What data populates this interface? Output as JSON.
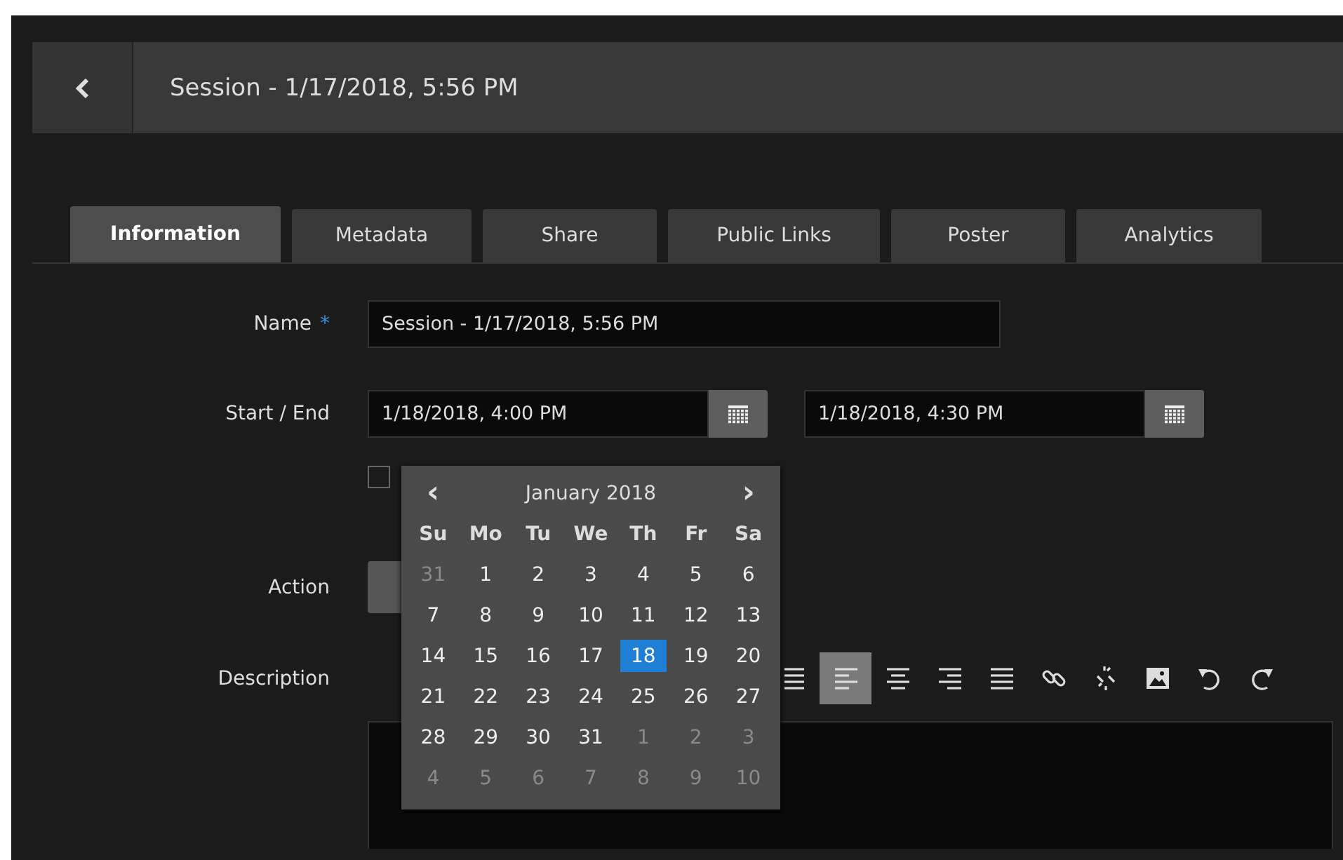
{
  "header": {
    "title": "Session - 1/17/2018, 5:56 PM"
  },
  "tabs": [
    {
      "label": "Information",
      "selected": true
    },
    {
      "label": "Metadata",
      "selected": false
    },
    {
      "label": "Share",
      "selected": false
    },
    {
      "label": "Public Links",
      "selected": false
    },
    {
      "label": "Poster",
      "selected": false
    },
    {
      "label": "Analytics",
      "selected": false
    }
  ],
  "form": {
    "name_label": "Name",
    "required_mark": "*",
    "name_value": "Session - 1/17/2018, 5:56 PM",
    "start_end_label": "Start / End",
    "start_value": "1/18/2018, 4:00 PM",
    "end_value": "1/18/2018, 4:30 PM",
    "all_day_checked": false,
    "action_label": "Action",
    "description_label": "Description"
  },
  "toolbar": [
    {
      "kind": "list",
      "selected": false
    },
    {
      "kind": "align-left",
      "selected": true
    },
    {
      "kind": "align-center",
      "selected": false
    },
    {
      "kind": "align-right",
      "selected": false
    },
    {
      "kind": "justify",
      "selected": false
    },
    {
      "kind": "link",
      "selected": false
    },
    {
      "kind": "unlink",
      "selected": false
    },
    {
      "kind": "image",
      "selected": false
    },
    {
      "kind": "undo",
      "selected": false
    },
    {
      "kind": "redo",
      "selected": false
    }
  ],
  "calendar": {
    "prev": "‹",
    "month": "January 2018",
    "next": "›",
    "weekdays": [
      "Su",
      "Mo",
      "Tu",
      "We",
      "Th",
      "Fr",
      "Sa"
    ],
    "weeks": [
      [
        {
          "label": "31",
          "muted": true,
          "selected": false
        },
        {
          "label": "1",
          "muted": false,
          "selected": false
        },
        {
          "label": "2",
          "muted": false,
          "selected": false
        },
        {
          "label": "3",
          "muted": false,
          "selected": false
        },
        {
          "label": "4",
          "muted": false,
          "selected": false
        },
        {
          "label": "5",
          "muted": false,
          "selected": false
        },
        {
          "label": "6",
          "muted": false,
          "selected": false
        }
      ],
      [
        {
          "label": "7",
          "muted": false,
          "selected": false
        },
        {
          "label": "8",
          "muted": false,
          "selected": false
        },
        {
          "label": "9",
          "muted": false,
          "selected": false
        },
        {
          "label": "10",
          "muted": false,
          "selected": false
        },
        {
          "label": "11",
          "muted": false,
          "selected": false
        },
        {
          "label": "12",
          "muted": false,
          "selected": false
        },
        {
          "label": "13",
          "muted": false,
          "selected": false
        }
      ],
      [
        {
          "label": "14",
          "muted": false,
          "selected": false
        },
        {
          "label": "15",
          "muted": false,
          "selected": false
        },
        {
          "label": "16",
          "muted": false,
          "selected": false
        },
        {
          "label": "17",
          "muted": false,
          "selected": false
        },
        {
          "label": "18",
          "muted": false,
          "selected": true
        },
        {
          "label": "19",
          "muted": false,
          "selected": false
        },
        {
          "label": "20",
          "muted": false,
          "selected": false
        }
      ],
      [
        {
          "label": "21",
          "muted": false,
          "selected": false
        },
        {
          "label": "22",
          "muted": false,
          "selected": false
        },
        {
          "label": "23",
          "muted": false,
          "selected": false
        },
        {
          "label": "24",
          "muted": false,
          "selected": false
        },
        {
          "label": "25",
          "muted": false,
          "selected": false
        },
        {
          "label": "26",
          "muted": false,
          "selected": false
        },
        {
          "label": "27",
          "muted": false,
          "selected": false
        }
      ],
      [
        {
          "label": "28",
          "muted": false,
          "selected": false
        },
        {
          "label": "29",
          "muted": false,
          "selected": false
        },
        {
          "label": "30",
          "muted": false,
          "selected": false
        },
        {
          "label": "31",
          "muted": false,
          "selected": false
        },
        {
          "label": "1",
          "muted": true,
          "selected": false
        },
        {
          "label": "2",
          "muted": true,
          "selected": false
        },
        {
          "label": "3",
          "muted": true,
          "selected": false
        }
      ],
      [
        {
          "label": "4",
          "muted": true,
          "selected": false
        },
        {
          "label": "5",
          "muted": true,
          "selected": false
        },
        {
          "label": "6",
          "muted": true,
          "selected": false
        },
        {
          "label": "7",
          "muted": true,
          "selected": false
        },
        {
          "label": "8",
          "muted": true,
          "selected": false
        },
        {
          "label": "9",
          "muted": true,
          "selected": false
        },
        {
          "label": "10",
          "muted": true,
          "selected": false
        }
      ]
    ]
  }
}
